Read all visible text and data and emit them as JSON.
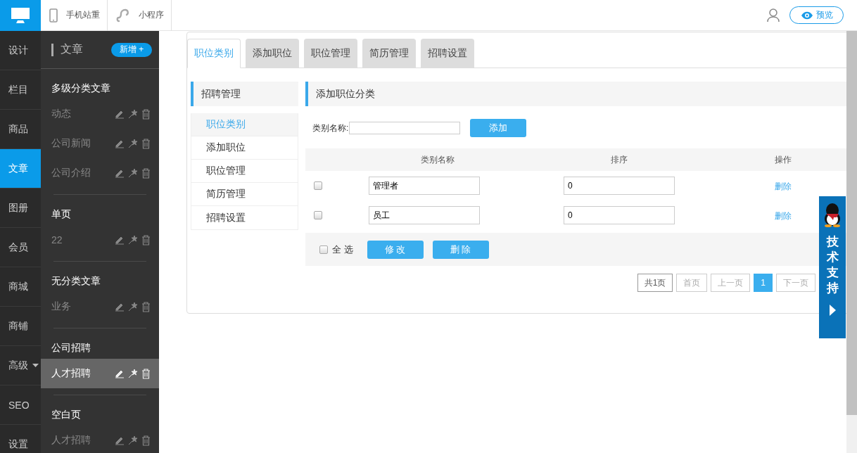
{
  "top_bar": {
    "tabs": [
      {
        "label": "手机站重",
        "kind": "phone"
      },
      {
        "label": "小程序",
        "kind": "link"
      }
    ],
    "preview_button": "预览"
  },
  "left_nav": [
    {
      "label": "设计",
      "selected": false,
      "dropdown": false
    },
    {
      "label": "栏目",
      "selected": false,
      "dropdown": false
    },
    {
      "label": "商品",
      "selected": false,
      "dropdown": false
    },
    {
      "label": "文章",
      "selected": true,
      "dropdown": false
    },
    {
      "label": "图册",
      "selected": false,
      "dropdown": false
    },
    {
      "label": "会员",
      "selected": false,
      "dropdown": false
    },
    {
      "label": "商城",
      "selected": false,
      "dropdown": false
    },
    {
      "label": "商铺",
      "selected": false,
      "dropdown": false
    },
    {
      "label": "高级",
      "selected": false,
      "dropdown": true
    },
    {
      "label": "SEO",
      "selected": false,
      "dropdown": false
    },
    {
      "label": "设置",
      "selected": false,
      "dropdown": false
    }
  ],
  "article_panel": {
    "title": "文章",
    "add_button": "新增 +",
    "groups": [
      {
        "title": "多级分类文章",
        "items": [
          {
            "label": "动态",
            "selected": false
          },
          {
            "label": "公司新闻",
            "selected": false
          },
          {
            "label": "公司介绍",
            "selected": false
          }
        ]
      },
      {
        "title": "单页",
        "items": [
          {
            "label": "22",
            "selected": false
          }
        ]
      },
      {
        "title": "无分类文章",
        "items": [
          {
            "label": "业务",
            "selected": false
          }
        ]
      },
      {
        "title": "公司招聘",
        "items": [
          {
            "label": "人才招聘",
            "selected": true
          }
        ]
      },
      {
        "title": "空白页",
        "items": [
          {
            "label": "人才招聘",
            "selected": false
          }
        ]
      }
    ]
  },
  "tabs": [
    {
      "label": "职位类别",
      "selected": true
    },
    {
      "label": "添加职位",
      "selected": false
    },
    {
      "label": "职位管理",
      "selected": false
    },
    {
      "label": "简历管理",
      "selected": false
    },
    {
      "label": "招聘设置",
      "selected": false
    }
  ],
  "sub_menu": {
    "title": "招聘管理",
    "items": [
      {
        "label": "职位类别",
        "selected": true
      },
      {
        "label": "添加职位",
        "selected": false
      },
      {
        "label": "职位管理",
        "selected": false
      },
      {
        "label": "简历管理",
        "selected": false
      },
      {
        "label": "招聘设置",
        "selected": false
      }
    ]
  },
  "panel": {
    "title": "添加职位分类",
    "form_label": "类别名称:",
    "add_button": "添加",
    "table": {
      "columns": [
        "类别名称",
        "排序",
        "操作"
      ],
      "rows": [
        {
          "checked": false,
          "name": "管理者",
          "order": "0",
          "action": "删除"
        },
        {
          "checked": false,
          "name": "员工",
          "order": "0",
          "action": "删除"
        }
      ]
    },
    "footer": {
      "select_all": "全 选",
      "checked": false,
      "buttons": [
        "修 改",
        "删 除"
      ]
    },
    "pagination": [
      {
        "label": "共1页",
        "selected": false,
        "disabled": false
      },
      {
        "label": "首页",
        "selected": false,
        "disabled": true
      },
      {
        "label": "上一页",
        "selected": false,
        "disabled": true
      },
      {
        "label": "1",
        "selected": true,
        "disabled": false
      },
      {
        "label": "下一页",
        "selected": false,
        "disabled": true
      }
    ]
  },
  "support_widget": {
    "label": "技术支持"
  }
}
